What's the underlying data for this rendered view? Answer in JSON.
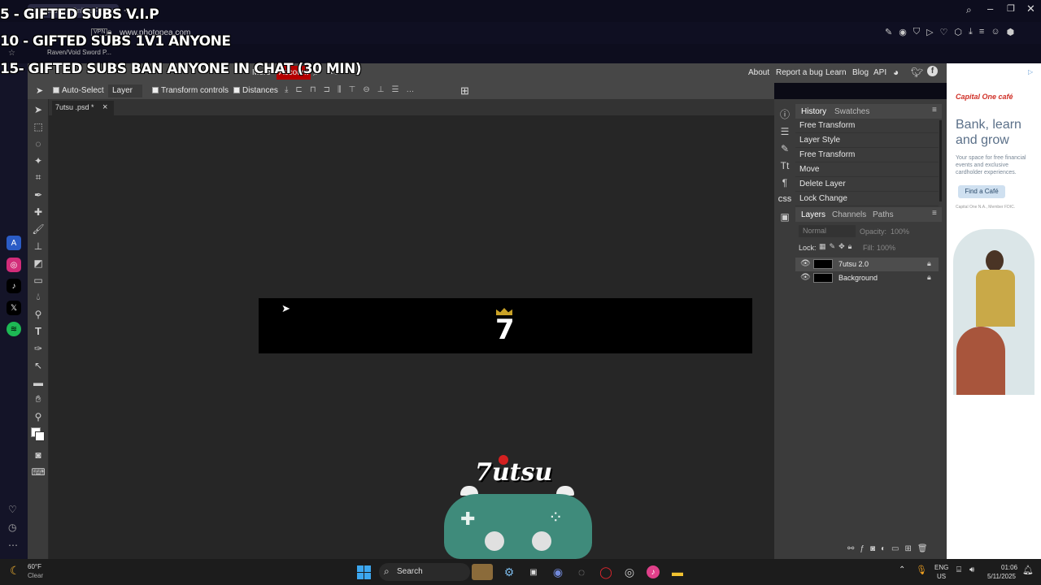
{
  "browser": {
    "tab_title": "Photopea | Online Photo Editor",
    "url": "www.photopea.com",
    "bookmark": "Raven/Void Sword P...",
    "vpn_label": "VPN"
  },
  "stream_overlay": {
    "line1": "5 - GIFTED SUBS V.I.P",
    "line2": "10 - GIFTED SUBS 1V1 ANYONE",
    "line3": "15- GIFTED SUBS BAN ANYONE IN CHAT (30 MIN)",
    "logo_text": "7utsu"
  },
  "menubar": {
    "more": "More",
    "account": "Account",
    "right_links": [
      "About",
      "Report a bug",
      "Learn",
      "Blog",
      "API"
    ]
  },
  "options": {
    "auto_select": "Auto-Select",
    "layer_select": "Layer",
    "transform_controls": "Transform controls",
    "distances": "Distances"
  },
  "document": {
    "tab_label": "7utsu .psd *",
    "close_glyph": "×",
    "logo_glyph": "7"
  },
  "history": {
    "tabs": [
      "History",
      "Swatches"
    ],
    "items": [
      "Free Transform",
      "Layer Style",
      "Free Transform",
      "Move",
      "Delete Layer",
      "Lock Change"
    ]
  },
  "layers_panel": {
    "tabs": [
      "Layers",
      "Channels",
      "Paths"
    ],
    "blend_mode": "Normal",
    "opacity_label": "Opacity:",
    "opacity": "100%",
    "lock_label": "Lock:",
    "fill_label": "Fill:",
    "fill": "100%",
    "layers": [
      {
        "name": "7utsu 2.0"
      },
      {
        "name": "Background"
      }
    ]
  },
  "ad": {
    "brand": "Capital One café",
    "headline": "Bank, learn and grow",
    "body": "Your space for free financial events and exclusive cardholder experiences.",
    "cta": "Find a Café",
    "disclaimer": "Capital One N.A., Member FDIC."
  },
  "taskbar": {
    "weather_temp": "60°F",
    "weather_desc": "Clear",
    "search": "Search",
    "lang_top": "ENG",
    "lang_bottom": "US",
    "time": "01:06",
    "date": "5/11/2025"
  },
  "colors": {
    "accent_red": "#b50000",
    "panel_bg": "#3b3b3b",
    "workspace_bg": "#262626"
  }
}
